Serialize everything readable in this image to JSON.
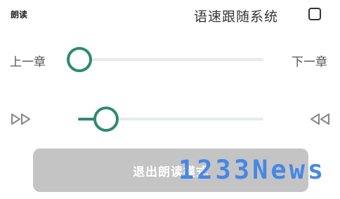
{
  "header": {
    "title": "朗读",
    "follow_system_label": "语速跟随系统",
    "follow_system_checked": false
  },
  "chapter_nav": {
    "prev_label": "上一章",
    "next_label": "下一章",
    "progress_fraction": 0.0
  },
  "speed": {
    "slow_icon": "slow-down-icon",
    "fast_icon": "speed-up-icon",
    "level_fraction": 0.15
  },
  "exit_button_label": "退出朗读模式",
  "watermark": "1233News",
  "colors": {
    "accent": "#2f8a70",
    "track": "#e4ecea",
    "button_bg": "#c4c4c4",
    "watermark": "#3f84e8"
  }
}
